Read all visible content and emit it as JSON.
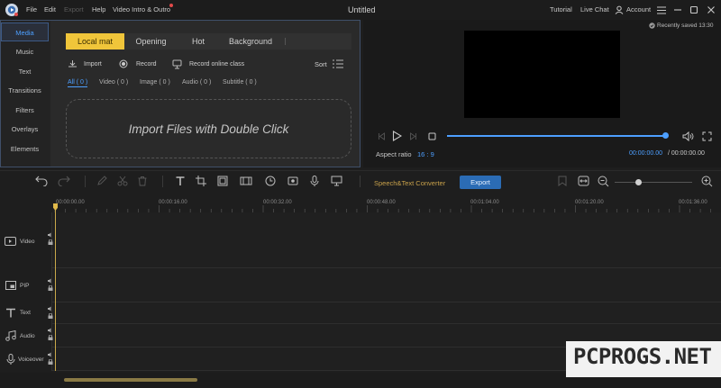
{
  "titlebar": {
    "menus": [
      "File",
      "Edit",
      "Export",
      "Help",
      "Video Intro & Outro"
    ],
    "title": "Untitled",
    "tutorial": "Tutorial",
    "live_chat": "Live Chat",
    "account": "Account",
    "recently_saved": "Recently saved 13:30"
  },
  "sidebar": {
    "items": [
      "Media",
      "Music",
      "Text",
      "Transitions",
      "Filters",
      "Overlays",
      "Elements"
    ]
  },
  "media": {
    "tabs": [
      "Local mat",
      "Opening",
      "Hot",
      "Background"
    ],
    "actions": {
      "import": "Import",
      "record": "Record",
      "record_online": "Record online class",
      "sort": "Sort"
    },
    "filters": [
      "All ( 0 )",
      "Video ( 0 )",
      "Image ( 0 )",
      "Audio ( 0 )",
      "Subtitle ( 0 )"
    ],
    "dropzone": "Import Files with Double Click"
  },
  "preview": {
    "aspect_label": "Aspect ratio",
    "aspect_value": "16 : 9",
    "time_current": "00:00:00.00",
    "time_total": "/ 00:00:00.00",
    "progress": 1.0
  },
  "timeline": {
    "speech_text": "Speech&Text Converter",
    "export": "Export",
    "zoom": 0.3,
    "ticks": [
      "00:00:00.00",
      "00:00:16.00",
      "00:00:32.00",
      "00:00:48.00",
      "00:01:04.00",
      "00:01:20.00",
      "00:01:36.00"
    ],
    "tracks": [
      "Video",
      "PIP",
      "Text",
      "Audio",
      "Voiceover"
    ]
  },
  "watermark": "PCPROGS.NET",
  "colors": {
    "accent": "#4d9fff",
    "tab_active": "#f0c53a",
    "export_btn": "#2b6cb5"
  }
}
